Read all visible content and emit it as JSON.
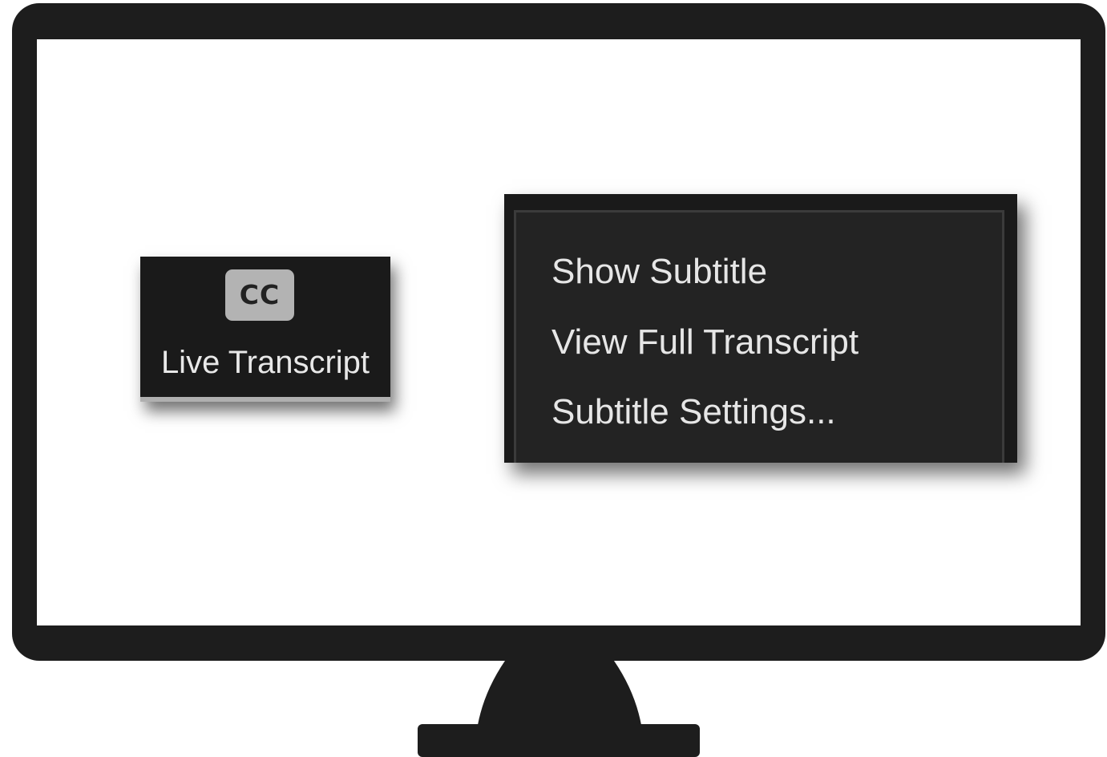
{
  "cc_button": {
    "icon_text": "CC",
    "label": "Live Transcript"
  },
  "context_menu": {
    "items": [
      {
        "label": "Show Subtitle"
      },
      {
        "label": "View Full Transcript"
      },
      {
        "label": "Subtitle Settings..."
      }
    ]
  },
  "colors": {
    "monitor": "#1d1d1d",
    "screen": "#ffffff",
    "menu_background": "#232323",
    "button_background": "#1a1a1a",
    "cc_badge": "#b3b3b3",
    "text": "#e6e6e6"
  },
  "icons": {
    "monitor": "monitor-icon",
    "closed_captions": "closed-captions-icon"
  }
}
